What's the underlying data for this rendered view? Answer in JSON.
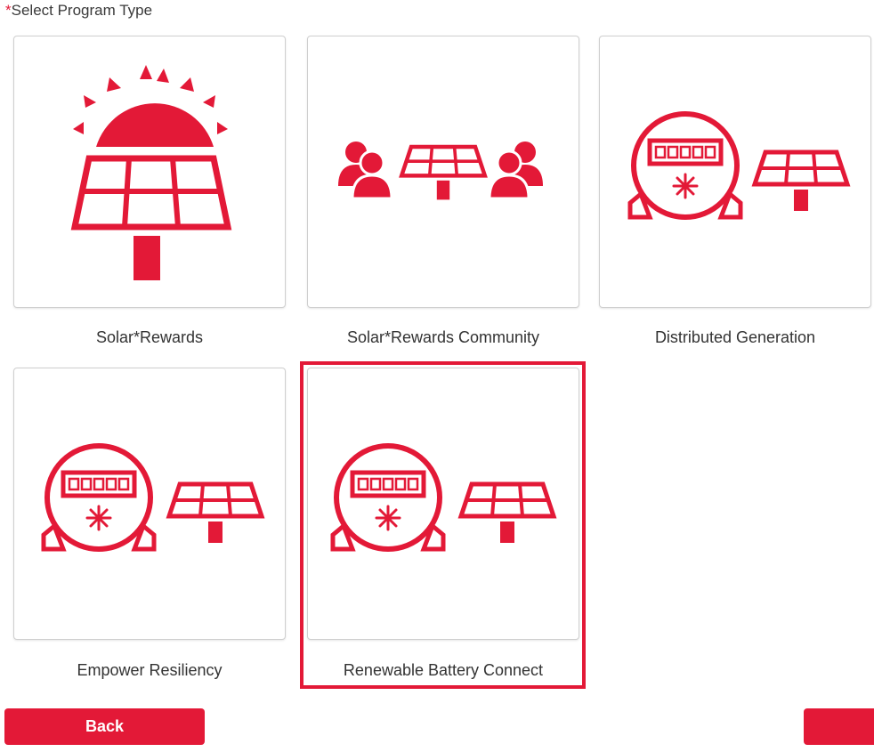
{
  "form": {
    "required_marker": "*",
    "label": "Select Program Type"
  },
  "programs": [
    {
      "label": "Solar*Rewards",
      "icon": "solar-panel-sun-icon",
      "selected": false
    },
    {
      "label": "Solar*Rewards Community",
      "icon": "community-solar-icon",
      "selected": false
    },
    {
      "label": "Distributed Generation",
      "icon": "meter-solar-icon",
      "selected": false
    },
    {
      "label": "Empower Resiliency",
      "icon": "meter-solar-icon",
      "selected": false
    },
    {
      "label": "Renewable Battery Connect",
      "icon": "meter-solar-icon",
      "selected": true
    }
  ],
  "buttons": {
    "back": "Back",
    "next": ""
  },
  "colors": {
    "accent": "#e31937",
    "card_border": "#cfcfcf",
    "text": "#333333"
  }
}
